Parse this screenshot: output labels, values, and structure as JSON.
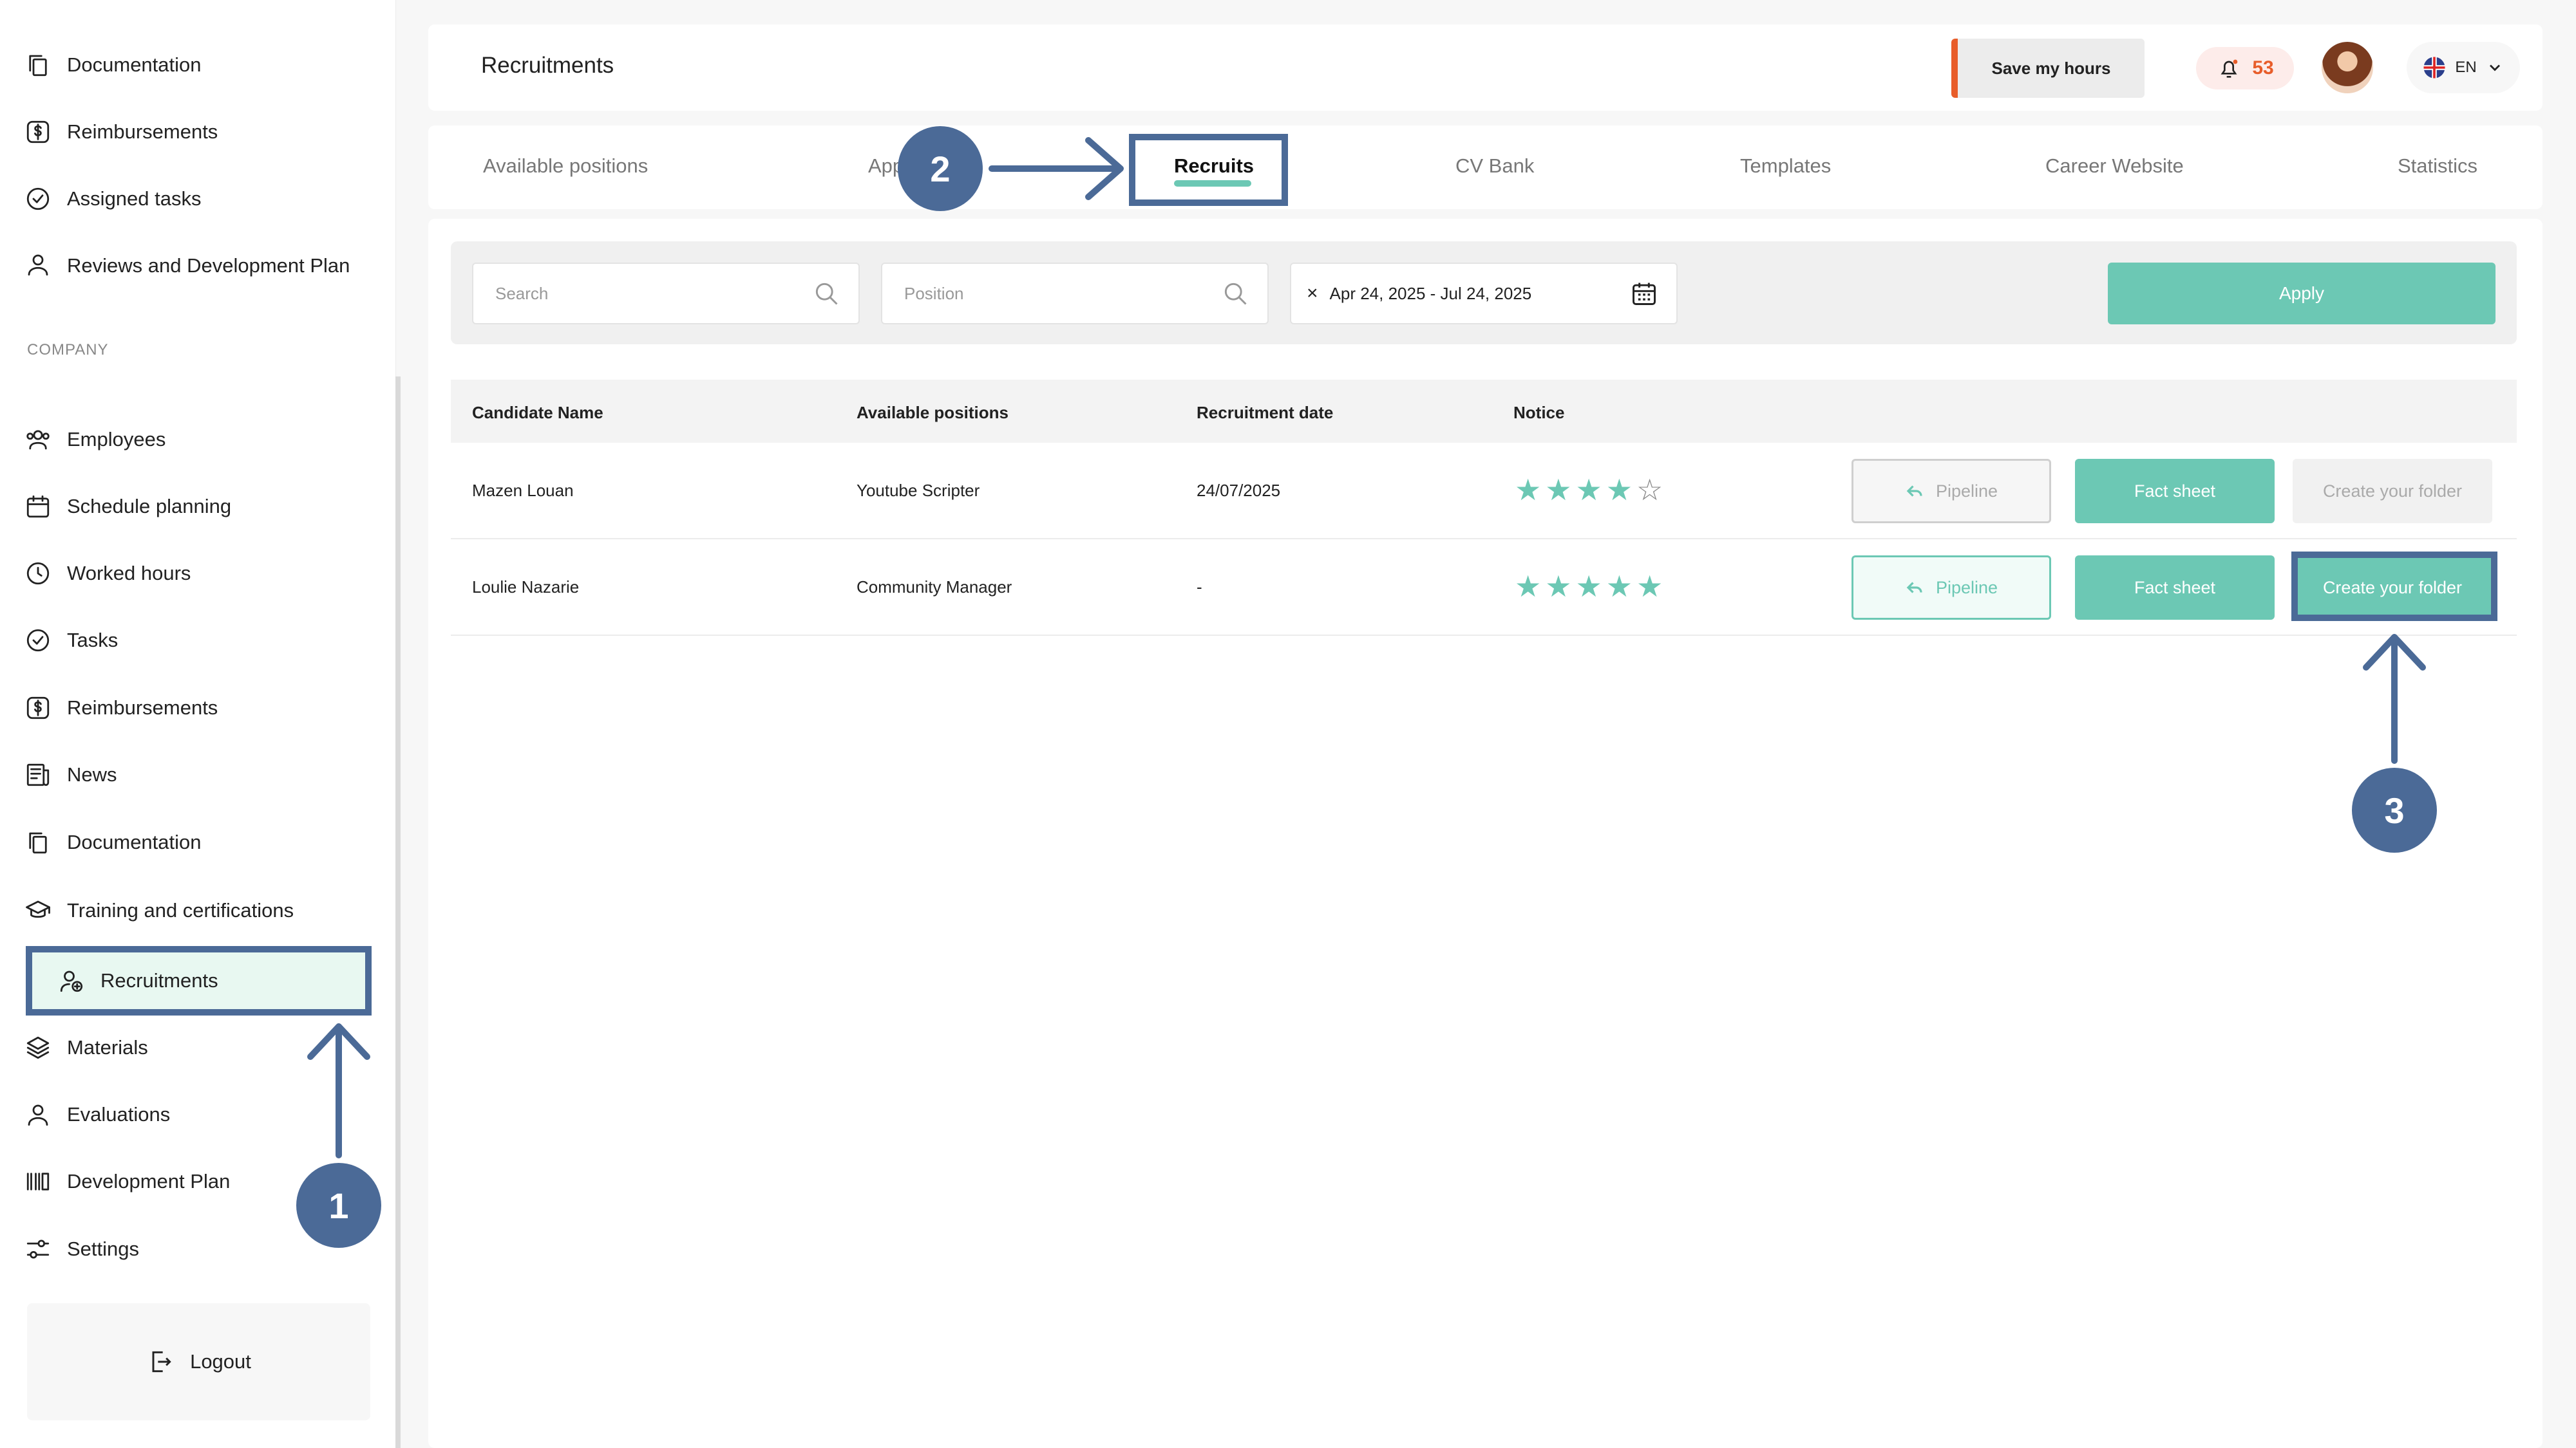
{
  "sidebar": {
    "items_top": [
      {
        "label": "Documentation",
        "icon": "documents-icon"
      },
      {
        "label": "Reimbursements",
        "icon": "dollar-icon"
      },
      {
        "label": "Assigned tasks",
        "icon": "check-circle-icon"
      },
      {
        "label": "Reviews and Development Plan",
        "icon": "user-icon"
      }
    ],
    "section_label": "COMPANY",
    "items": [
      {
        "label": "Employees",
        "icon": "users-icon"
      },
      {
        "label": "Schedule planning",
        "icon": "calendar-icon"
      },
      {
        "label": "Worked hours",
        "icon": "clock-icon"
      },
      {
        "label": "Tasks",
        "icon": "check-circle-icon"
      },
      {
        "label": "Reimbursements",
        "icon": "dollar-icon"
      },
      {
        "label": "News",
        "icon": "news-icon"
      },
      {
        "label": "Documentation",
        "icon": "documents-icon"
      },
      {
        "label": "Training and certifications",
        "icon": "graduation-cap-icon"
      },
      {
        "label": "Recruitments",
        "icon": "add-user-icon",
        "active": true
      },
      {
        "label": "Materials",
        "icon": "layers-icon"
      },
      {
        "label": "Evaluations",
        "icon": "user-icon"
      },
      {
        "label": "Development Plan",
        "icon": "bars-icon"
      },
      {
        "label": "Settings",
        "icon": "sliders-icon"
      }
    ],
    "logout_label": "Logout"
  },
  "header": {
    "title": "Recruitments",
    "save_hours_label": "Save my hours",
    "notification_count": "53",
    "language": "EN"
  },
  "tabs": [
    {
      "label": "Available positions",
      "active": false
    },
    {
      "label": "App",
      "active": false
    },
    {
      "label": "Recruits",
      "active": true
    },
    {
      "label": "CV Bank",
      "active": false
    },
    {
      "label": "Templates",
      "active": false
    },
    {
      "label": "Career Website",
      "active": false
    },
    {
      "label": "Statistics",
      "active": false
    }
  ],
  "filters": {
    "search_placeholder": "Search",
    "position_placeholder": "Position",
    "date_range": "Apr 24, 2025 - Jul 24, 2025",
    "clear_symbol": "×",
    "apply_label": "Apply"
  },
  "table": {
    "columns": [
      "Candidate Name",
      "Available positions",
      "Recruitment date",
      "Notice"
    ],
    "rows": [
      {
        "name": "Mazen Louan",
        "position": "Youtube Scripter",
        "date": "24/07/2025",
        "rating": 4,
        "pipeline": "Pipeline",
        "fact_sheet": "Fact sheet",
        "folder": "Create your folder",
        "folder_enabled": false
      },
      {
        "name": "Loulie Nazarie",
        "position": "Community Manager",
        "date": "-",
        "rating": 5,
        "pipeline": "Pipeline",
        "fact_sheet": "Fact sheet",
        "folder": "Create your folder",
        "folder_enabled": true
      }
    ],
    "max_rating": 5
  },
  "annotations": {
    "step1": "1",
    "step2": "2",
    "step3": "3",
    "color": "#4b6a97"
  },
  "colors": {
    "accent": "#6cc8b4",
    "alert": "#e85d2a",
    "annotation": "#4b6a97"
  }
}
